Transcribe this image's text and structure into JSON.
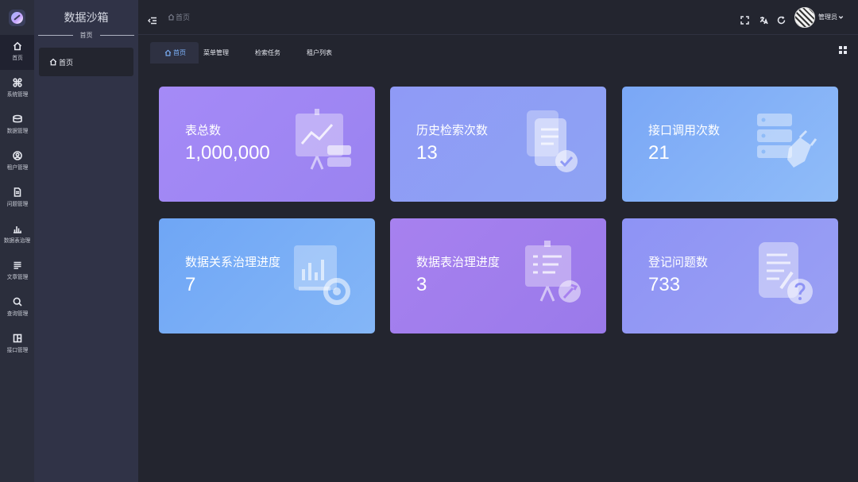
{
  "app": {
    "brand": "数据沙箱",
    "sub": "首页"
  },
  "rail": [
    {
      "label": "首页",
      "icon": "home-icon"
    },
    {
      "label": "系统管理",
      "icon": "command-icon"
    },
    {
      "label": "数据管理",
      "icon": "database-icon"
    },
    {
      "label": "租户管理",
      "icon": "user-circle-icon"
    },
    {
      "label": "问题管理",
      "icon": "document-icon"
    },
    {
      "label": "数据表治理",
      "icon": "bar-chart-icon"
    },
    {
      "label": "文章管理",
      "icon": "list-icon"
    },
    {
      "label": "查询管理",
      "icon": "search-icon"
    },
    {
      "label": "接口管理",
      "icon": "layout-icon"
    }
  ],
  "side_menu": {
    "home_label": "首页"
  },
  "topbar": {
    "breadcrumb": "首页",
    "username": "管理员"
  },
  "tabs": [
    {
      "label": "首页",
      "active": true
    },
    {
      "label": "菜单管理",
      "active": false
    },
    {
      "label": "检索任务",
      "active": false
    },
    {
      "label": "租户列表",
      "active": false
    }
  ],
  "cards": [
    {
      "title": "表总数",
      "value": "1,000,000",
      "icon": "presentation-chart-icon"
    },
    {
      "title": "历史检索次数",
      "value": "13",
      "icon": "document-check-icon"
    },
    {
      "title": "接口调用次数",
      "value": "21",
      "icon": "server-plug-icon"
    },
    {
      "title": "数据关系治理进度",
      "value": "7",
      "icon": "chart-gear-icon"
    },
    {
      "title": "数据表治理进度",
      "value": "3",
      "icon": "board-wrench-icon"
    },
    {
      "title": "登记问题数",
      "value": "733",
      "icon": "document-question-icon"
    }
  ],
  "colors": {
    "background": "#23252f",
    "rail": "#2b2e3c",
    "sidebar": "#303347",
    "accent": "#7eb5ff"
  }
}
